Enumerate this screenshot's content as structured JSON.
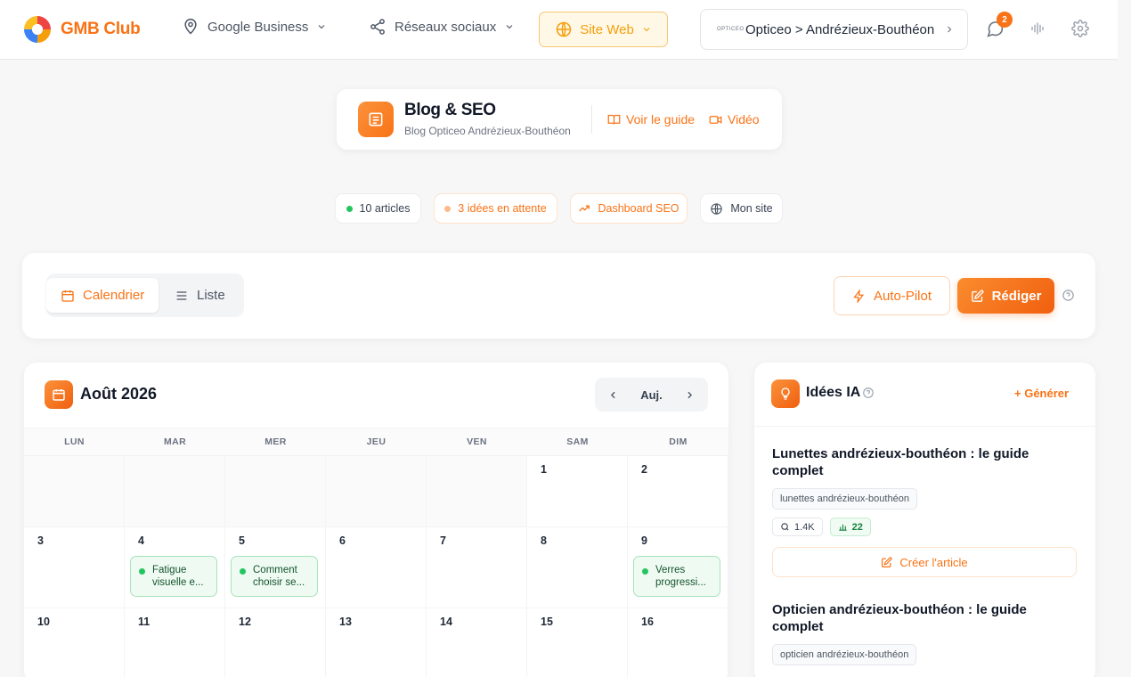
{
  "app": {
    "brand": "GMB Club",
    "brand_color": "#f97316"
  },
  "nav": {
    "google_business": "Google Business",
    "social": "Réseaux sociaux",
    "site": "Site Web",
    "location": "Opticeo > Andrézieux-Bouthéon",
    "location_logo": "OPTICEO",
    "notifications_count": "2"
  },
  "header": {
    "title": "Blog & SEO",
    "subtitle": "Blog Opticeo Andrézieux-Bouthéon",
    "guide": "Voir le guide",
    "video": "Vidéo"
  },
  "pills": {
    "articles": "10 articles",
    "ideas": "3 idées en attente",
    "dashboard": "Dashboard SEO",
    "site": "Mon site"
  },
  "toolbar": {
    "calendar": "Calendrier",
    "list": "Liste",
    "autopilot": "Auto-Pilot",
    "write": "Rédiger"
  },
  "calendar": {
    "title": "Août 2026",
    "today": "Auj.",
    "days": [
      "LUN",
      "MAR",
      "MER",
      "JEU",
      "VEN",
      "SAM",
      "DIM"
    ],
    "cells": [
      {
        "num": ""
      },
      {
        "num": ""
      },
      {
        "num": ""
      },
      {
        "num": ""
      },
      {
        "num": ""
      },
      {
        "num": "1"
      },
      {
        "num": "2"
      },
      {
        "num": "3"
      },
      {
        "num": "4",
        "event": "Fatigue visuelle e..."
      },
      {
        "num": "5",
        "event": "Comment choisir se..."
      },
      {
        "num": "6"
      },
      {
        "num": "7"
      },
      {
        "num": "8"
      },
      {
        "num": "9",
        "event": "Verres progressi..."
      },
      {
        "num": "10"
      },
      {
        "num": "11"
      },
      {
        "num": "12"
      },
      {
        "num": "13"
      },
      {
        "num": "14"
      },
      {
        "num": "15"
      },
      {
        "num": "16"
      }
    ],
    "event_color": "#22c55e"
  },
  "ideas": {
    "title": "Idées IA",
    "generate": "+ Générer",
    "items": [
      {
        "title": "Lunettes andrézieux-bouthéon : le guide complet",
        "keyword": "lunettes andrézieux-bouthéon",
        "volume": "1.4K",
        "difficulty": "22",
        "create": "Créer l'article"
      },
      {
        "title": "Opticien andrézieux-bouthéon : le guide complet",
        "keyword": "opticien andrézieux-bouthéon"
      }
    ]
  }
}
